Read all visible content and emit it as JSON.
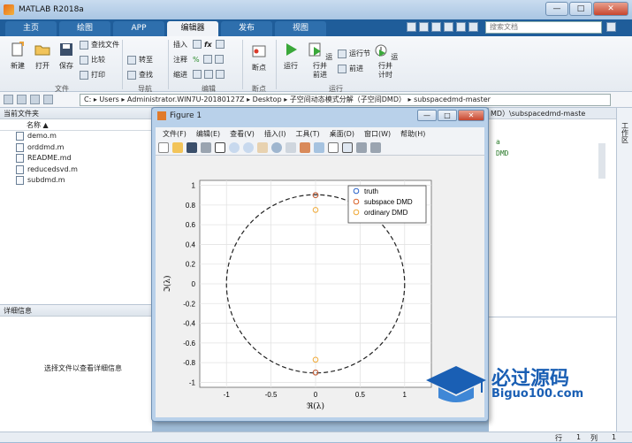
{
  "window": {
    "title": "MATLAB R2018a",
    "min": "—",
    "max": "□",
    "close": "✕"
  },
  "tabs": [
    {
      "label": "主页"
    },
    {
      "label": "绘图"
    },
    {
      "label": "APP"
    },
    {
      "label": "编辑器"
    },
    {
      "label": "发布"
    },
    {
      "label": "视图"
    }
  ],
  "search": {
    "placeholder": "搜索文档"
  },
  "ribbon": {
    "new": "新建",
    "open": "打开",
    "save": "保存",
    "find_files": "查找文件",
    "compare": "比较",
    "print": "打印",
    "goto": "转至",
    "find": "查找",
    "insert": "插入",
    "comment": "注释",
    "indent": "缩进",
    "breakpoints": "断点",
    "run": "运行",
    "run_advance_l1": "运行并",
    "run_advance_l2": "前进",
    "run_section": "运行节",
    "advance": "前进",
    "run_time_l1": "运行并",
    "run_time_l2": "计时",
    "group_file": "文件",
    "group_nav": "导航",
    "group_edit": "编辑",
    "group_bp": "断点",
    "group_run": "运行"
  },
  "address": {
    "path_parts": [
      "C:",
      "Users",
      "Administrator.WIN7U-20180127Z",
      "Desktop",
      "子空间动态模式分解（子空间DMD）",
      "subspacedmd-master"
    ]
  },
  "current_folder": {
    "title": "当前文件夹",
    "column_name": "名称 ▲",
    "files": [
      "demo.m",
      "orddmd.m",
      "README.md",
      "reducedsvd.m",
      "subdmd.m"
    ]
  },
  "details": {
    "title": "详细信息",
    "message": "选择文件以查看详细信息"
  },
  "right_panel": {
    "label": "工作区"
  },
  "cmd_header": "MD）\\subspacedmd-maste",
  "cmd_lines": [
    "a",
    "DMD"
  ],
  "status": {
    "row_label": "行",
    "row": "1",
    "col_label": "列",
    "col": "1"
  },
  "figure": {
    "title": "Figure 1",
    "menu": [
      "文件(F)",
      "编辑(E)",
      "查看(V)",
      "插入(I)",
      "工具(T)",
      "桌面(D)",
      "窗口(W)",
      "帮助(H)"
    ]
  },
  "chart_data": {
    "type": "scatter",
    "xlabel": "ℜ(λ)",
    "ylabel": "ℑ(λ)",
    "xlim": [
      -1.3,
      1.3
    ],
    "ylim": [
      -1.05,
      1.05
    ],
    "xticks": [
      -1,
      -0.5,
      0,
      0.5,
      1
    ],
    "yticks": [
      -1,
      -0.8,
      -0.6,
      -0.4,
      -0.2,
      0,
      0.2,
      0.4,
      0.6,
      0.8,
      1
    ],
    "grid": true,
    "legend_position": "top-right",
    "unit_circle": true,
    "series": [
      {
        "name": "truth",
        "color": "#2a63c9",
        "points": [
          [
            0,
            0.9
          ],
          [
            0,
            -0.9
          ]
        ]
      },
      {
        "name": "subspace DMD",
        "color": "#d9632a",
        "points": [
          [
            0,
            0.9
          ],
          [
            0,
            -0.9
          ]
        ]
      },
      {
        "name": "ordinary DMD",
        "color": "#f0a935",
        "points": [
          [
            0,
            0.75
          ],
          [
            0,
            -0.77
          ]
        ]
      }
    ]
  },
  "watermark": {
    "cn": "必过源码",
    "en": "Biguo100.com"
  }
}
